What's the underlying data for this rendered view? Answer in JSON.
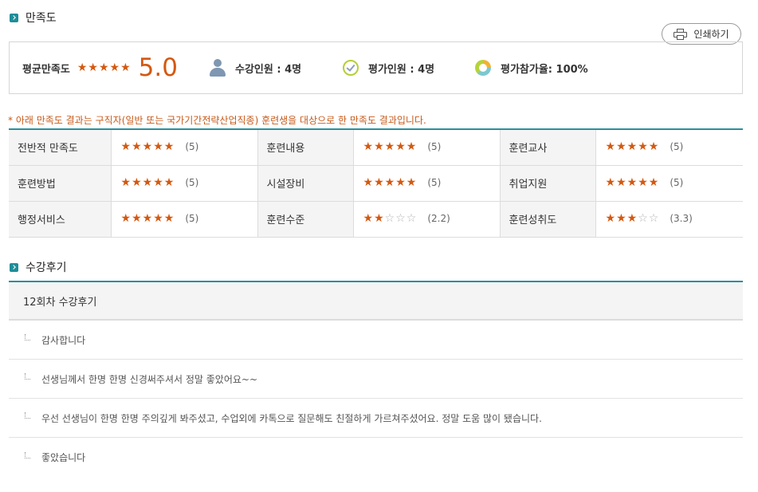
{
  "satisfaction": {
    "section_title": "만족도",
    "print_label": "인쇄하기",
    "avg_label": "평균만족도",
    "avg_stars": 5,
    "avg_score": "5.0",
    "enrolled_label": "수강인원 : 4명",
    "raters_label": "평가인원 : 4명",
    "participation_label": "평가참가율: 100%",
    "notice": "* 아래 만족도 결과는 구직자(일반 또는 국가기간전략산업직종) 훈련생을 대상으로 한 만족도 결과입니다.",
    "rows": [
      [
        {
          "label": "전반적 만족도",
          "stars": 5,
          "count": "(5)"
        },
        {
          "label": "훈련내용",
          "stars": 5,
          "count": "(5)"
        },
        {
          "label": "훈련교사",
          "stars": 5,
          "count": "(5)"
        }
      ],
      [
        {
          "label": "훈련방법",
          "stars": 5,
          "count": "(5)"
        },
        {
          "label": "시설장비",
          "stars": 5,
          "count": "(5)"
        },
        {
          "label": "취업지원",
          "stars": 5,
          "count": "(5)"
        }
      ],
      [
        {
          "label": "행정서비스",
          "stars": 5,
          "count": "(5)"
        },
        {
          "label": "훈련수준",
          "stars": 2,
          "count": "(2.2)"
        },
        {
          "label": "훈련성취도",
          "stars": 3,
          "count": "(3.3)"
        }
      ]
    ]
  },
  "reviews": {
    "section_title": "수강후기",
    "session_title": "12회차 수강후기",
    "items": [
      "감사합니다",
      "선생님께서 한명 한명 신경써주셔서 정말 좋았어요~~",
      "우선 선생님이 한명 한명 주의깊게 봐주셨고, 수업외에 카톡으로 질문해도 친절하게 가르쳐주셨어요. 정말 도움 많이 됐습니다.",
      "좋았습니다"
    ]
  },
  "colors": {
    "accent": "#2a8f9c",
    "star": "#d4580f",
    "notice": "#c75a1a"
  },
  "icons": [
    "section-arrow-icon",
    "printer-icon",
    "person-icon",
    "check-circle-icon",
    "donut-chart-icon",
    "reply-indent-icon",
    "star-icon"
  ]
}
